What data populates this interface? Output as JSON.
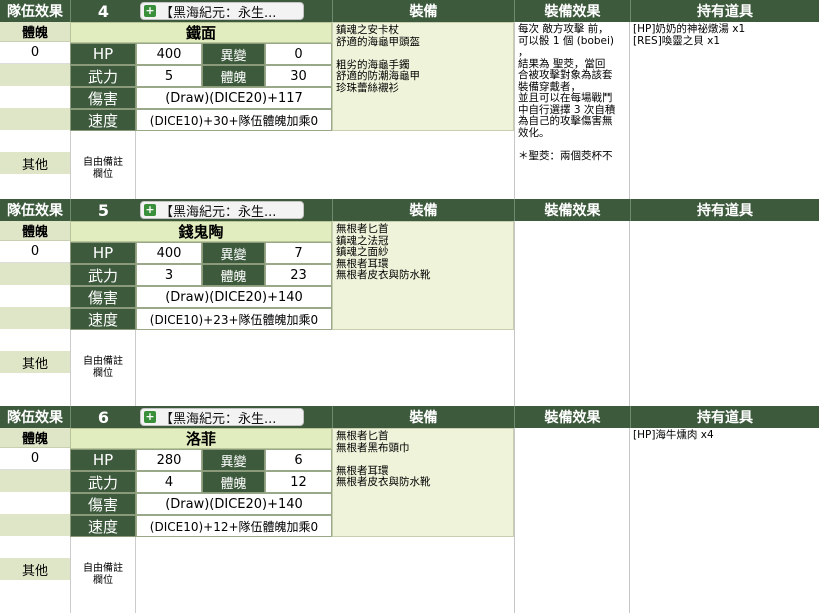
{
  "headers": {
    "team_effect": "隊伍效果",
    "equipment": "裝備",
    "equipment_effect": "裝備效果",
    "items": "持有道具"
  },
  "labels": {
    "physique": "體魄",
    "other": "其他",
    "hp": "HP",
    "abnormal": "異變",
    "force": "武力",
    "body": "體魄",
    "damage": "傷害",
    "speed": "速度",
    "note": "自由備註\n欄位"
  },
  "characters": [
    {
      "number": "4",
      "dropdown": "【黑海紀元：永生...",
      "name": "鐵面",
      "physique_value": "0",
      "hp": "400",
      "abnormal": "0",
      "force": "5",
      "body": "30",
      "damage": "(Draw)(DICE20)+117",
      "speed": "(DICE10)+30+隊伍體魄加乘0",
      "equipment": "鎮魂之安卡杖\n舒適的海龜甲頭盔\n\n粗劣的海龜手鐲\n舒適的防潮海龜甲\n珍珠蕾絲襯衫",
      "equipment_effect": "每次 敵方攻擊 前，\n可以骰 1 個 (bobei)\n，\n結果為 聖茭，當回\n合被攻擊對象為該套\n裝備穿戴者，\n並且可以在每場戰鬥\n中自行選擇 3 次自積\n為自己的攻擊傷害無\n效化。\n\n＊聖茭：兩個茭杯不",
      "items": "[HP]奶奶的神祕燉湯 x1\n[RES]喚靈之貝 x1"
    },
    {
      "number": "5",
      "dropdown": "【黑海紀元：永生...",
      "name": "錢鬼陶",
      "physique_value": "0",
      "hp": "400",
      "abnormal": "7",
      "force": "3",
      "body": "23",
      "damage": "(Draw)(DICE20)+140",
      "speed": "(DICE10)+23+隊伍體魄加乘0",
      "equipment": "無根者匕首\n鎮魂之法冠\n鎮魂之面紗\n無根者耳環\n無根者皮衣與防水靴",
      "equipment_effect": "",
      "items": ""
    },
    {
      "number": "6",
      "dropdown": "【黑海紀元：永生...",
      "name": "洛菲",
      "physique_value": "0",
      "hp": "280",
      "abnormal": "6",
      "force": "4",
      "body": "12",
      "damage": "(Draw)(DICE20)+140",
      "speed": "(DICE10)+12+隊伍體魄加乘0",
      "equipment": "無根者匕首\n無根者黑布頭巾\n\n無根者耳環\n無根者皮衣與防水靴",
      "equipment_effect": "",
      "items": "[HP]海牛燻肉 x4"
    }
  ]
}
